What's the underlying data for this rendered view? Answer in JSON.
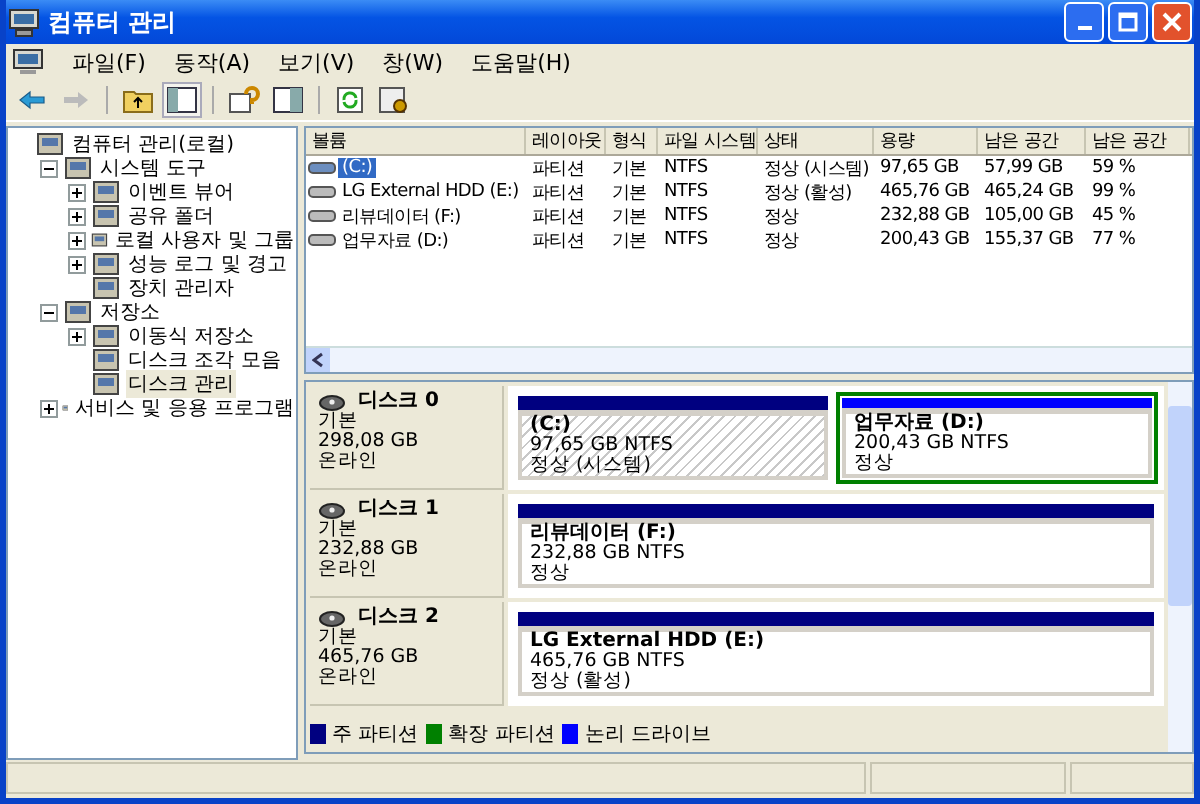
{
  "window": {
    "title": "컴퓨터 관리"
  },
  "menu": [
    "파일(F)",
    "동작(A)",
    "보기(V)",
    "창(W)",
    "도움말(H)"
  ],
  "tree": {
    "label": "컴퓨터 관리(로컬)",
    "selected": false,
    "children": [
      {
        "label": "시스템 도구",
        "expanded": true,
        "selected": false,
        "children": [
          {
            "label": "이벤트 뷰어",
            "expanded": false,
            "selected": false
          },
          {
            "label": "공유 폴더",
            "expanded": false,
            "selected": false
          },
          {
            "label": "로컬 사용자 및 그룹",
            "expanded": false,
            "selected": false
          },
          {
            "label": "성능 로그 및 경고",
            "expanded": false,
            "selected": false
          },
          {
            "label": "장치 관리자",
            "selected": false
          }
        ]
      },
      {
        "label": "저장소",
        "expanded": true,
        "selected": false,
        "children": [
          {
            "label": "이동식 저장소",
            "expanded": false,
            "selected": false
          },
          {
            "label": "디스크 조각 모음",
            "selected": false
          },
          {
            "label": "디스크 관리",
            "selected": true
          }
        ]
      },
      {
        "label": "서비스 및 응용 프로그램",
        "expanded": false,
        "selected": false
      }
    ]
  },
  "volume_table": {
    "columns": [
      "볼륨",
      "레이아웃",
      "형식",
      "파일 시스템",
      "상태",
      "용량",
      "남은 공간",
      "남은 공간"
    ],
    "rows": [
      {
        "selected": true,
        "cells": [
          "(C:)",
          "파티션",
          "기본",
          "NTFS",
          "정상 (시스템)",
          "97,65 GB",
          "57,99 GB",
          "59 %"
        ]
      },
      {
        "selected": false,
        "cells": [
          "LG External HDD (E:)",
          "파티션",
          "기본",
          "NTFS",
          "정상 (활성)",
          "465,76 GB",
          "465,24 GB",
          "99 %"
        ]
      },
      {
        "selected": false,
        "cells": [
          "리뷰데이터 (F:)",
          "파티션",
          "기본",
          "NTFS",
          "정상",
          "232,88 GB",
          "105,00 GB",
          "45 %"
        ]
      },
      {
        "selected": false,
        "cells": [
          "업무자료 (D:)",
          "파티션",
          "기본",
          "NTFS",
          "정상",
          "200,43 GB",
          "155,37 GB",
          "77 %"
        ]
      }
    ]
  },
  "disks": [
    {
      "name": "디스크 0",
      "type": "기본",
      "size": "298,08 GB",
      "status": "온라인",
      "partitions": [
        {
          "kind": "primary",
          "selected": true,
          "name": "(C:)",
          "size": "97,65 GB NTFS",
          "status": "정상 (시스템)"
        },
        {
          "kind": "logical",
          "selected": false,
          "name": "업무자료  (D:)",
          "size": "200,43 GB NTFS",
          "status": "정상"
        }
      ]
    },
    {
      "name": "디스크 1",
      "type": "기본",
      "size": "232,88 GB",
      "status": "온라인",
      "partitions": [
        {
          "kind": "primary",
          "selected": false,
          "name": "리뷰데이터  (F:)",
          "size": "232,88 GB NTFS",
          "status": "정상"
        }
      ]
    },
    {
      "name": "디스크 2",
      "type": "기본",
      "size": "465,76 GB",
      "status": "온라인",
      "partitions": [
        {
          "kind": "primary",
          "selected": false,
          "name": "LG External HDD  (E:)",
          "size": "465,76 GB NTFS",
          "status": "정상 (활성)"
        }
      ]
    }
  ],
  "legend": [
    {
      "label": "주 파티션",
      "color": "#000080"
    },
    {
      "label": "확장 파티션",
      "color": "#008000"
    },
    {
      "label": "논리 드라이브",
      "color": "#0000ff"
    }
  ]
}
